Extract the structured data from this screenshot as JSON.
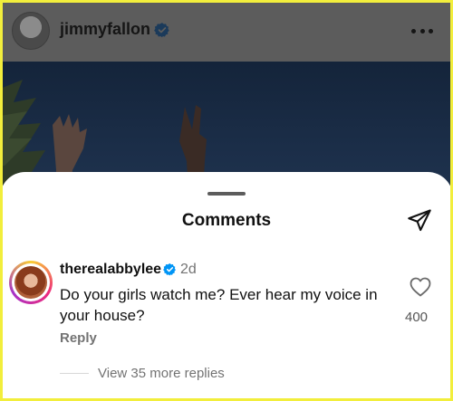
{
  "post": {
    "username": "jimmyfallon",
    "verified": true,
    "avatar_icon": "profile-photo",
    "more_icon": "more-horizontal-icon"
  },
  "comments_sheet": {
    "title": "Comments",
    "send_icon": "paper-plane-icon",
    "comment": {
      "username": "therealabbylee",
      "verified": true,
      "time": "2d",
      "text": "Do your girls watch me? Ever hear my voice in your house?",
      "likes": "400",
      "reply_label": "Reply",
      "view_replies_label": "View 35 more replies"
    }
  },
  "colors": {
    "verified_blue": "#0095f6",
    "dim_overlay": "#5c5c5c",
    "frame_yellow": "#f2ee3c",
    "secondary_text": "#737373"
  }
}
